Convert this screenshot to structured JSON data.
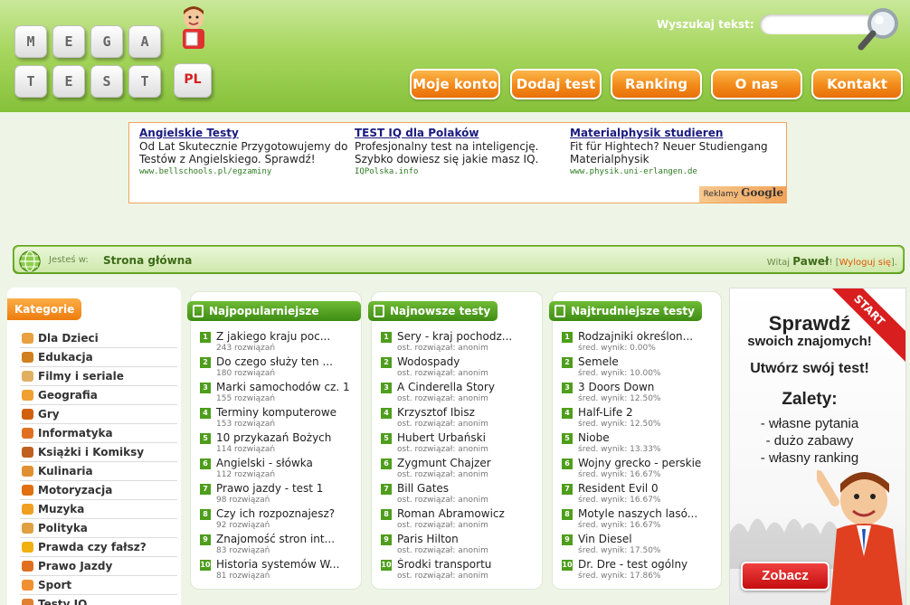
{
  "logo": {
    "tiles": [
      "M",
      "E",
      "G",
      "A",
      "T",
      "E",
      "S",
      "T"
    ],
    "suffix": "PL"
  },
  "search": {
    "label": "Wyszukaj tekst:",
    "placeholder": "",
    "icon": "magnifier-icon"
  },
  "nav": [
    "Moje konto",
    "Dodaj test",
    "Ranking",
    "O nas",
    "Kontakt"
  ],
  "ads": [
    {
      "title": "Angielskie Testy",
      "text": "Od Lat Skutecznie Przygotowujemy do Testów z Angielskiego. Sprawdź!",
      "url": "www.bellschools.pl/egzaminy"
    },
    {
      "title": "TEST IQ dla Polaków",
      "text": "Profesjonalny test na inteligencję. Szybko dowiesz się jakie masz IQ.",
      "url": "IQPolska.info"
    },
    {
      "title": "Materialphysik studieren",
      "text": "Fit für Hightech? Neuer Studiengang Materialphysik",
      "url": "www.physik.uni-erlangen.de"
    }
  ],
  "ad_badge": {
    "prefix": "Reklamy",
    "brand": "Google"
  },
  "breadcrumb": {
    "label": "Jesteś w:",
    "page": "Strona główna",
    "welcome": "Witaj",
    "user": "Paweł",
    "logout": "Wyloguj się",
    "open_bracket": "! [",
    "close_bracket": "]."
  },
  "sidebar": {
    "title": "Kategorie",
    "categories": [
      {
        "label": "Dla Dzieci",
        "color": "#e8a040"
      },
      {
        "label": "Edukacja",
        "color": "#d08020"
      },
      {
        "label": "Filmy i seriale",
        "color": "#e0b060"
      },
      {
        "label": "Geografia",
        "color": "#f0a030"
      },
      {
        "label": "Gry",
        "color": "#d06010"
      },
      {
        "label": "Informatyka",
        "color": "#e07020"
      },
      {
        "label": "Książki i Komiksy",
        "color": "#c06020"
      },
      {
        "label": "Kulinaria",
        "color": "#e09030"
      },
      {
        "label": "Motoryzacja",
        "color": "#e07010"
      },
      {
        "label": "Muzyka",
        "color": "#f0a020"
      },
      {
        "label": "Polityka",
        "color": "#e0a040"
      },
      {
        "label": "Prawda czy fałsz?",
        "color": "#f0b010"
      },
      {
        "label": "Prawo Jazdy",
        "color": "#e07020"
      },
      {
        "label": "Sport",
        "color": "#f09030"
      },
      {
        "label": "Testy IQ",
        "color": "#e08030"
      }
    ]
  },
  "popular": {
    "title": "Najpopularniejsze testy",
    "items": [
      {
        "n": "1",
        "title": "Z jakiego kraju poc...",
        "sub": "243 rozwiązań"
      },
      {
        "n": "2",
        "title": "Do czego służy ten ...",
        "sub": "180 rozwiązań"
      },
      {
        "n": "3",
        "title": "Marki samochodów cz. 1",
        "sub": "155 rozwiązań"
      },
      {
        "n": "4",
        "title": "Terminy komputerowe",
        "sub": "153 rozwiązań"
      },
      {
        "n": "5",
        "title": "10 przykazań Bożych",
        "sub": "114 rozwiązań"
      },
      {
        "n": "6",
        "title": "Angielski - słówka",
        "sub": "112 rozwiązań"
      },
      {
        "n": "7",
        "title": "Prawo jazdy - test 1",
        "sub": "98 rozwiązań"
      },
      {
        "n": "8",
        "title": "Czy ich rozpoznajesz?",
        "sub": "92 rozwiązań"
      },
      {
        "n": "9",
        "title": "Znajomość stron int...",
        "sub": "83 rozwiązań"
      },
      {
        "n": "10",
        "title": "Historia systemów W...",
        "sub": "81 rozwiązań"
      }
    ]
  },
  "newest": {
    "title": "Najnowsze testy",
    "items": [
      {
        "n": "1",
        "title": "Sery - kraj pochodz...",
        "sub": "ost. rozwiązał: anonim"
      },
      {
        "n": "2",
        "title": "Wodospady",
        "sub": "ost. rozwiązał: anonim"
      },
      {
        "n": "3",
        "title": "A Cinderella Story",
        "sub": "ost. rozwiązał: anonim"
      },
      {
        "n": "4",
        "title": "Krzysztof Ibisz",
        "sub": "ost. rozwiązał: anonim"
      },
      {
        "n": "5",
        "title": "Hubert Urbański",
        "sub": "ost. rozwiązał: anonim"
      },
      {
        "n": "6",
        "title": "Zygmunt Chajzer",
        "sub": "ost. rozwiązał: anonim"
      },
      {
        "n": "7",
        "title": "Bill Gates",
        "sub": "ost. rozwiązał: anonim"
      },
      {
        "n": "8",
        "title": "Roman Abramowicz",
        "sub": "ost. rozwiązał: anonim"
      },
      {
        "n": "9",
        "title": "Paris Hilton",
        "sub": "ost. rozwiązał: anonim"
      },
      {
        "n": "10",
        "title": "Środki transportu",
        "sub": "ost. rozwiązał: anonim"
      }
    ]
  },
  "hardest": {
    "title": "Najtrudniejsze testy",
    "items": [
      {
        "n": "1",
        "title": "Rodzajniki określon...",
        "sub": "śred. wynik: 0.00%"
      },
      {
        "n": "2",
        "title": "Semele",
        "sub": "śred. wynik: 10.00%"
      },
      {
        "n": "3",
        "title": "3 Doors Down",
        "sub": "śred. wynik: 12.50%"
      },
      {
        "n": "4",
        "title": "Half-Life 2",
        "sub": "śred. wynik: 12.50%"
      },
      {
        "n": "5",
        "title": "Niobe",
        "sub": "śred. wynik: 13.33%"
      },
      {
        "n": "6",
        "title": "Wojny grecko - perskie",
        "sub": "śred. wynik: 16.67%"
      },
      {
        "n": "7",
        "title": "Resident Evil 0",
        "sub": "śred. wynik: 16.67%"
      },
      {
        "n": "8",
        "title": "Motyle naszych lasó...",
        "sub": "śred. wynik: 16.67%"
      },
      {
        "n": "9",
        "title": "Vin Diesel",
        "sub": "śred. wynik: 17.50%"
      },
      {
        "n": "10",
        "title": "Dr. Dre - test ogólny",
        "sub": "śred. wynik: 17.86%"
      }
    ]
  },
  "promo": {
    "ribbon": "START",
    "line1": "Sprawdź",
    "line2": "swoich znajomych!",
    "line3": "Utwórz swój test!",
    "line4": "Zalety:",
    "points": [
      "- własne pytania",
      "- dużo zabawy",
      "- własny ranking"
    ],
    "button": "Zobacz"
  },
  "colors": {
    "accent_orange": "#f38a18",
    "green": "#4e9e1c",
    "header_green": "#a7d65e",
    "promo_red": "#d81e1e"
  }
}
